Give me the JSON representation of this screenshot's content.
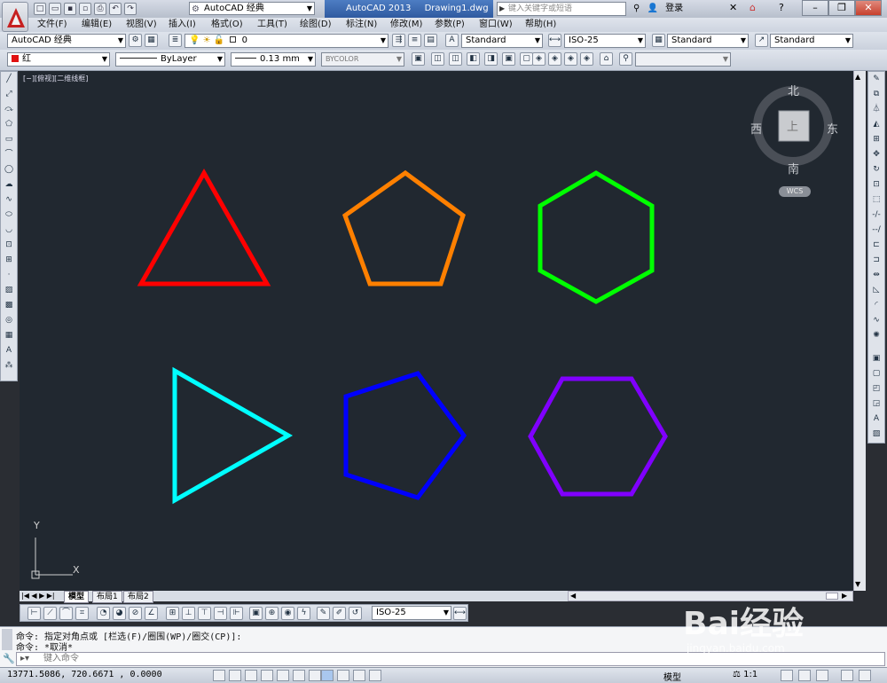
{
  "app": {
    "title": "AutoCAD 2013",
    "document": "Drawing1.dwg",
    "workspace": "AutoCAD 经典",
    "search_placeholder": "键入关键字或短语",
    "login_label": "登录"
  },
  "menu": [
    "文件(F)",
    "编辑(E)",
    "视图(V)",
    "插入(I)",
    "格式(O)",
    "工具(T)",
    "绘图(D)",
    "标注(N)",
    "修改(M)",
    "参数(P)",
    "窗口(W)",
    "帮助(H)"
  ],
  "toolbar2": {
    "workspace": "AutoCAD 经典",
    "layer": "0",
    "text_style": "Standard",
    "dim_style": "ISO-25",
    "table_style": "Standard",
    "multileader_style": "Standard"
  },
  "toolbar3": {
    "color": "红",
    "linetype": "ByLayer",
    "lineweight": "0.13 mm",
    "plotstyle": "BYCOLOR"
  },
  "viewport_label": "[−][俯视][二维线框]",
  "viewcube": {
    "n": "北",
    "s": "南",
    "e": "东",
    "w": "西",
    "face": "上",
    "wcs": "WCS"
  },
  "ucs": {
    "x": "X",
    "y": "Y"
  },
  "layout_tabs": [
    "模型",
    "布局1",
    "布局2"
  ],
  "dim_toolbar": {
    "style": "ISO-25"
  },
  "command": {
    "line1": "命令: 指定对角点或 [栏选(F)/圈围(WP)/圈交(CP)]:",
    "line2": "命令: *取消*",
    "placeholder": "键入命令"
  },
  "status": {
    "coords": "13771.5086, 720.6671 , 0.0000",
    "model_label": "模型",
    "scale": "1:1"
  },
  "shapes": [
    {
      "kind": "triangle",
      "color": "#ff0000"
    },
    {
      "kind": "pentagon",
      "color": "#ff8000"
    },
    {
      "kind": "hexagon",
      "color": "#00ff00"
    },
    {
      "kind": "triangle",
      "color": "#00ffff"
    },
    {
      "kind": "pentagon",
      "color": "#0000ff"
    },
    {
      "kind": "hexagon",
      "color": "#8000ff"
    }
  ],
  "watermark": {
    "brand": "Bai经验",
    "url": "jingyan.baidu.com"
  }
}
